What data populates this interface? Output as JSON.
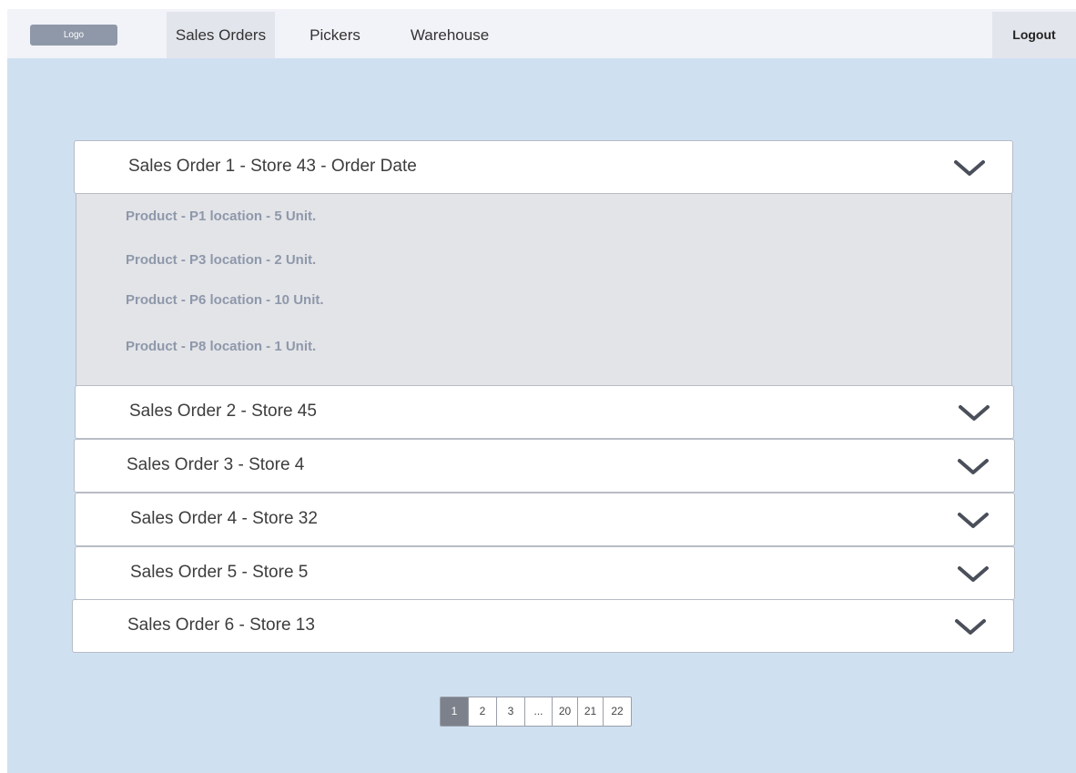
{
  "navbar": {
    "logo": "Logo",
    "items": [
      {
        "label": "Sales Orders"
      },
      {
        "label": "Pickers"
      },
      {
        "label": "Warehouse"
      }
    ],
    "logout": "Logout"
  },
  "orders": [
    {
      "title": "Sales Order 1 - Store 43 - Order Date"
    },
    {
      "title": "Sales Order 2 - Store 45"
    },
    {
      "title": "Sales Order 3 - Store 4"
    },
    {
      "title": "Sales Order 4 - Store 32"
    },
    {
      "title": "Sales Order 5 - Store 5"
    },
    {
      "title": "Sales Order 6 - Store 13"
    }
  ],
  "expanded_products": [
    "Product  - P1 location - 5 Unit.",
    "Product - P3 location - 2 Unit.",
    "Product - P6 location - 10 Unit.",
    "Product - P8 location - 1 Unit."
  ],
  "pagination": {
    "pages": [
      "1",
      "2",
      "3",
      "...",
      "20",
      "21",
      "22"
    ],
    "current": "1"
  },
  "colors": {
    "background": "#cfe0f1",
    "navbar": "#f2f3f8",
    "active_nav": "#e3e5ec",
    "expanded_panel": "#e3e4e8",
    "product_text": "#8e98aa",
    "current_page": "#7c818b"
  }
}
